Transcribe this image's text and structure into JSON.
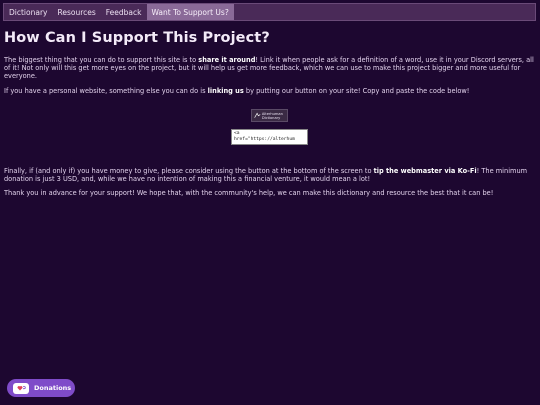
{
  "nav": {
    "items": [
      {
        "label": "Dictionary"
      },
      {
        "label": "Resources"
      },
      {
        "label": "Feedback"
      },
      {
        "label": "Want To Support Us?"
      }
    ]
  },
  "page": {
    "title": "How Can I Support This Project?",
    "p1_a": "The biggest thing that you can do to support this site is to ",
    "p1_b": "share it around",
    "p1_c": "! Link it when people ask for a definition of a word, use it in your Discord servers, all of it! Not only will this get more eyes on the project, but it will help us get more feedback, which we can use to make this project bigger and more useful for everyone.",
    "p2_a": "If you have a personal website, something else you can do is ",
    "p2_b": "linking us",
    "p2_c": " by putting our button on your site! Copy and paste the code below!",
    "badge_text": "Alterhuman Dictionary",
    "code_snippet": "<a\nhref=\"https://alterhum",
    "p3_a": "Finally, if (and only if) you have money to give, please consider using the button at the bottom of the screen to ",
    "p3_b": "tip the webmaster via Ko-Fi",
    "p3_c": "! The minimum donation is just 3 USD, and, while we have no intention of making this a financial venture, it would mean a lot!",
    "p4": "Thank you in advance for your support! We hope that, with the community's help, we can make this dictionary and resource the best that it can be!"
  },
  "donate": {
    "label": "Donations",
    "icon": "kofi-cup-icon"
  },
  "colors": {
    "background": "#1d0730",
    "nav": "#4a2a58",
    "nav_active": "#8a6a98",
    "donate": "#7f4bc9"
  }
}
